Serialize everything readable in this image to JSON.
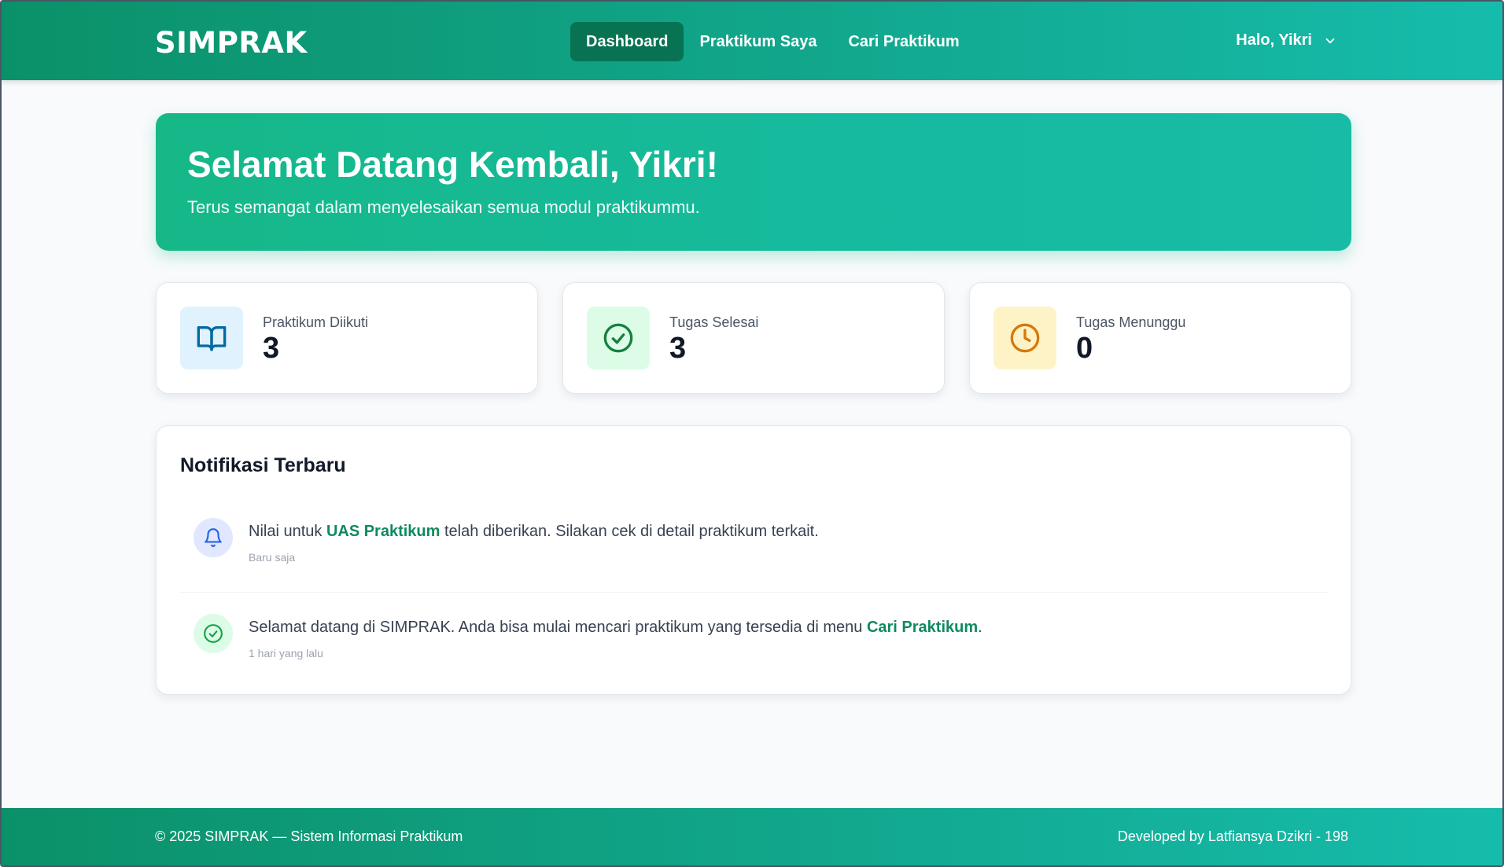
{
  "header": {
    "brand": "SIMPRAK",
    "nav": [
      {
        "label": "Dashboard",
        "active": true
      },
      {
        "label": "Praktikum Saya",
        "active": false
      },
      {
        "label": "Cari Praktikum",
        "active": false
      }
    ],
    "user_greeting": "Halo, Yikri",
    "user_menu_icon": "chevron-down-icon"
  },
  "welcome": {
    "title": "Selamat Datang Kembali, Yikri!",
    "subtitle": "Terus semangat dalam menyelesaikan semua modul praktikummu."
  },
  "stats": [
    {
      "label": "Praktikum Diikuti",
      "value": "3",
      "icon": "book-open-icon",
      "bg": "#e0f2fe",
      "color": "#0369a1"
    },
    {
      "label": "Tugas Selesai",
      "value": "3",
      "icon": "check-circle-icon",
      "bg": "#dcfce7",
      "color": "#15803d"
    },
    {
      "label": "Tugas Menunggu",
      "value": "0",
      "icon": "clock-icon",
      "bg": "#fef3c7",
      "color": "#d97706"
    }
  ],
  "notifications": {
    "title": "Notifikasi Terbaru",
    "items": [
      {
        "icon": "bell-icon",
        "icon_bg": "#e0e7ff",
        "icon_color": "#2563eb",
        "text_before": "Nilai untuk ",
        "highlight": "UAS Praktikum",
        "text_after": " telah diberikan. Silakan cek di detail praktikum terkait.",
        "time": "Baru saja"
      },
      {
        "icon": "check-circle-icon",
        "icon_bg": "#dcfce7",
        "icon_color": "#16a34a",
        "text_before": "Selamat datang di SIMPRAK. Anda bisa mulai mencari praktikum yang tersedia di menu ",
        "highlight": "Cari Praktikum",
        "text_after": ".",
        "time": "1 hari yang lalu"
      }
    ]
  },
  "footer": {
    "left": "© 2025 SIMPRAK — Sistem Informasi Praktikum",
    "right": "Developed by Latfiansya Dzikri - 198"
  },
  "colors": {
    "primary": "#10b981",
    "primary_dark": "#087353",
    "accent_text": "#0f8a5f"
  }
}
